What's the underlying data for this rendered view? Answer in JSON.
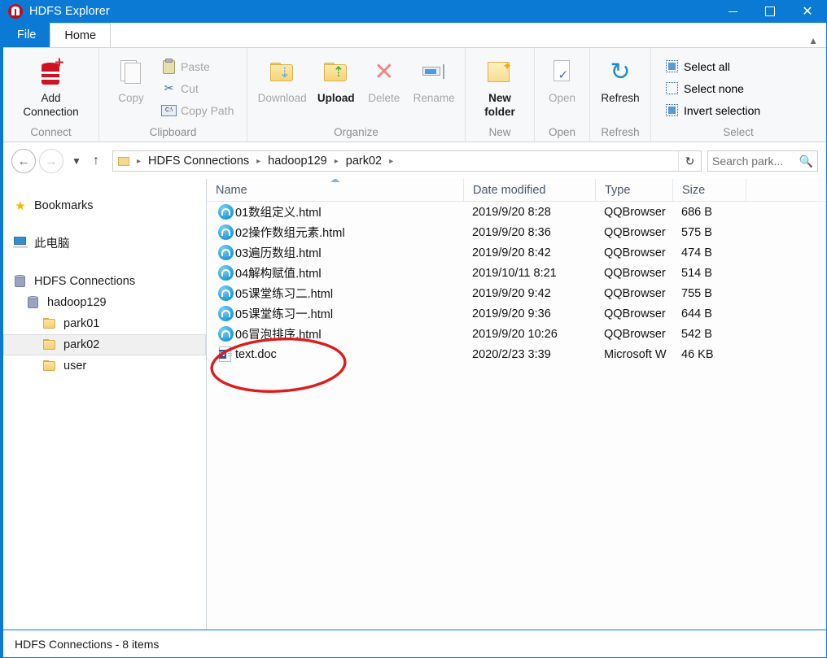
{
  "window": {
    "title": "HDFS Explorer",
    "app_icon": "hadoop-elephant-icon",
    "minimize": "–",
    "maximize": "□",
    "close": "✕",
    "accent_color": "#0b7ad5"
  },
  "tabs": {
    "file": "File",
    "home": "Home",
    "collapse_icon": "chevron-up-icon"
  },
  "ribbon": {
    "groups": [
      {
        "label": "Connect",
        "buttons": [
          {
            "label_line1": "Add",
            "label_line2": "Connection",
            "icon": "database-add-icon",
            "enabled": true
          }
        ]
      },
      {
        "label": "Clipboard",
        "buttons": [
          {
            "label_line1": "Copy",
            "label_line2": "",
            "icon": "copy-pages-icon",
            "enabled": false
          }
        ],
        "small_items": [
          {
            "label": "Paste",
            "icon": "paste-clipboard-icon",
            "enabled": false
          },
          {
            "label": "Cut",
            "icon": "scissors-icon",
            "enabled": false
          },
          {
            "label": "Copy Path",
            "icon": "command-prompt-icon",
            "enabled": false
          }
        ]
      },
      {
        "label": "Organize",
        "buttons": [
          {
            "label_line1": "Download",
            "label_line2": "",
            "icon": "folder-download-icon",
            "enabled": false
          },
          {
            "label_line1": "Upload",
            "label_line2": "",
            "icon": "folder-upload-icon",
            "enabled": true
          },
          {
            "label_line1": "Delete",
            "label_line2": "",
            "icon": "red-x-icon",
            "enabled": false
          },
          {
            "label_line1": "Rename",
            "label_line2": "",
            "icon": "rename-field-icon",
            "enabled": false
          }
        ]
      },
      {
        "label": "New",
        "buttons": [
          {
            "label_line1": "New",
            "label_line2": "folder",
            "icon": "new-folder-icon",
            "enabled": true
          }
        ]
      },
      {
        "label": "Open",
        "buttons": [
          {
            "label_line1": "Open",
            "label_line2": "",
            "icon": "open-document-icon",
            "enabled": false
          }
        ]
      },
      {
        "label": "Refresh",
        "buttons": [
          {
            "label_line1": "Refresh",
            "label_line2": "",
            "icon": "refresh-arrows-icon",
            "enabled": true
          }
        ]
      },
      {
        "label": "Select",
        "small_items": [
          {
            "label": "Select all",
            "icon": "select-all-icon",
            "enabled": true
          },
          {
            "label": "Select none",
            "icon": "select-none-icon",
            "enabled": true
          },
          {
            "label": "Invert selection",
            "icon": "invert-selection-icon",
            "enabled": true
          }
        ]
      }
    ]
  },
  "addressbar": {
    "back_icon": "arrow-left-icon",
    "forward_icon": "arrow-right-icon",
    "history_icon": "chevron-down-icon",
    "up_icon": "arrow-up-icon",
    "folder_icon": "folder-icon",
    "breadcrumbs": [
      "HDFS Connections",
      "hadoop129",
      "park02"
    ],
    "separator": "▸",
    "refresh_icon": "refresh-icon",
    "search_placeholder": "Search park...",
    "search_value": "",
    "search_icon": "magnifier-icon"
  },
  "sidebar": {
    "items": [
      {
        "label": "Bookmarks",
        "icon": "star-icon",
        "indent": 0,
        "selected": false
      },
      {
        "label": "此电脑",
        "icon": "this-pc-icon",
        "indent": 0,
        "selected": false
      },
      {
        "label": "HDFS Connections",
        "icon": "server-icon",
        "indent": 0,
        "selected": false
      },
      {
        "label": "hadoop129",
        "icon": "server-icon",
        "indent": 1,
        "selected": false
      },
      {
        "label": "park01",
        "icon": "folder-icon",
        "indent": 2,
        "selected": false
      },
      {
        "label": "park02",
        "icon": "folder-icon",
        "indent": 2,
        "selected": true
      },
      {
        "label": "user",
        "icon": "folder-icon",
        "indent": 2,
        "selected": false
      }
    ]
  },
  "filelist": {
    "columns": [
      "Name",
      "Date modified",
      "Type",
      "Size"
    ],
    "sort_column": "Name",
    "sort_direction": "ascending",
    "rows": [
      {
        "name": "01数组定义.html",
        "date": "2019/9/20 8:28",
        "type": "QQBrowser",
        "size": "686 B",
        "icon": "qq-browser-icon"
      },
      {
        "name": "02操作数组元素.html",
        "date": "2019/9/20 8:36",
        "type": "QQBrowser",
        "size": "575 B",
        "icon": "qq-browser-icon"
      },
      {
        "name": "03遍历数组.html",
        "date": "2019/9/20 8:42",
        "type": "QQBrowser",
        "size": "474 B",
        "icon": "qq-browser-icon"
      },
      {
        "name": "04解构赋值.html",
        "date": "2019/10/11 8:21",
        "type": "QQBrowser",
        "size": "514 B",
        "icon": "qq-browser-icon"
      },
      {
        "name": "05课堂练习二.html",
        "date": "2019/9/20 9:42",
        "type": "QQBrowser",
        "size": "755 B",
        "icon": "qq-browser-icon"
      },
      {
        "name": "05课堂练习一.html",
        "date": "2019/9/20 9:36",
        "type": "QQBrowser",
        "size": "644 B",
        "icon": "qq-browser-icon"
      },
      {
        "name": "06冒泡排序.html",
        "date": "2019/9/20 10:26",
        "type": "QQBrowser",
        "size": "542 B",
        "icon": "qq-browser-icon"
      },
      {
        "name": "text.doc",
        "date": "2020/2/23 3:39",
        "type": "Microsoft W",
        "size": "46 KB",
        "icon": "word-doc-icon"
      }
    ]
  },
  "annotation": {
    "shape": "ellipse",
    "color": "#e01b1b",
    "targets": "text.doc"
  },
  "statusbar": {
    "text": "HDFS Connections - 8 items"
  }
}
